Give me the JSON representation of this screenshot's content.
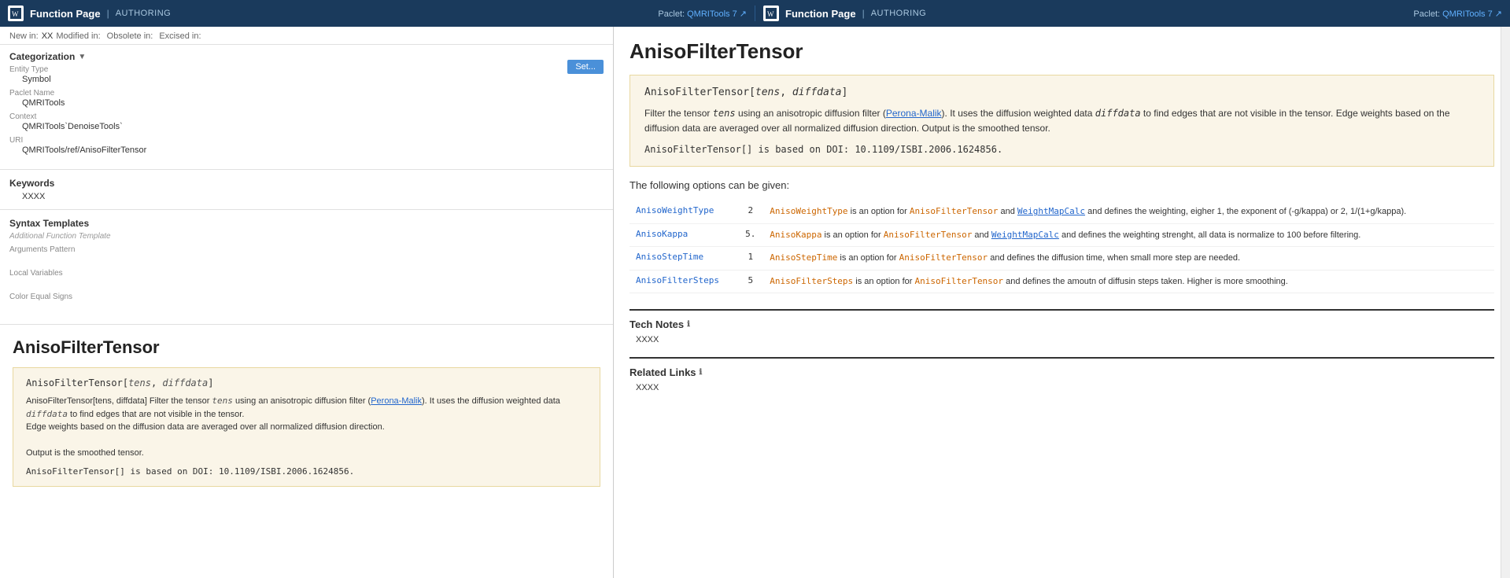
{
  "header": {
    "icon_label": "WL",
    "left_title": "Function Page",
    "separator": "|",
    "left_authoring": "AUTHORING",
    "paclet_label": "Paclet:",
    "paclet_name": "QMRITools",
    "paclet_version": "7",
    "right_title": "Function Page",
    "right_authoring": "AUTHORING"
  },
  "left_panel": {
    "meta": {
      "new_in_label": "New in:",
      "new_in_value": "XX",
      "modified_label": "Modified in:",
      "modified_value": "",
      "obsolete_label": "Obsolete in:",
      "obsolete_value": "",
      "excised_label": "Excised in:",
      "excised_value": ""
    },
    "categorization": {
      "header": "Categorization",
      "entity_type_label": "Entity Type",
      "entity_type_value": "Symbol",
      "paclet_name_label": "Paclet Name",
      "paclet_name_value": "QMRITools",
      "context_label": "Context",
      "context_value": "QMRITools`DenoiseTools`",
      "uri_label": "URI",
      "uri_value": "QMRITools/ref/AnisoFilterTensor"
    },
    "keywords": {
      "header": "Keywords",
      "value": "XXXX"
    },
    "syntax": {
      "header": "Syntax Templates",
      "sub_label": "Additional Function Template",
      "args_pattern_label": "Arguments Pattern",
      "args_pattern_value": "",
      "local_vars_label": "Local Variables",
      "local_vars_value": "",
      "color_equal_label": "Color Equal Signs",
      "color_equal_value": ""
    },
    "set_button": "Set..."
  },
  "function": {
    "title": "AnisoFilterTensor",
    "code_box": {
      "signature": "AnisoFilterTensor[tens, diffdata]",
      "sig_name": "AnisoFilterTensor",
      "sig_arg1": "tens",
      "sig_arg2": "diffdata",
      "description": "Filter the tensor tens using an anisotropic diffusion filter (Perona-Malik). It uses the diffusion weighted data diffdata to find edges that are not visible in the tensor. Edge weights based on the diffusion data are averaged over all normalized diffusion direction. Output is the smoothed tensor.",
      "doi_prefix": "AnisoFilterTensor[] is based on DOI:",
      "doi_value": "10.1109/ISBI.2006.1624856."
    }
  },
  "right_panel": {
    "title": "AnisoFilterTensor",
    "code_box": {
      "signature_name": "AnisoFilterTensor",
      "sig_arg1": "tens",
      "sig_arg2": "diffdata",
      "description_parts": [
        "Filter the tensor ",
        "tens",
        " using an anisotropic diffusion filter (",
        "Perona-Malik",
        "). It uses the diffusion weighted data ",
        "diffdata",
        " to find edges that are not visible in the tensor. Edge weights based on the diffusion data are averaged over all normalized diffusion direction. Output is the smoothed tensor."
      ],
      "doi_code": "AnisoFilterTensor[]",
      "doi_text": "is based on DOI: 10.1109/ISBI.2006.1624856."
    },
    "options_heading": "The following options can be given:",
    "options": [
      {
        "name": "AnisoWeightType",
        "value": "2",
        "description": "AnisoWeightType is an option for AnisoFilterTensor and WeightMapCalc and defines the weighting, eigher 1, the exponent of (-g/kappa) or 2, 1/(1+g/kappa)."
      },
      {
        "name": "AnisoKappa",
        "value": "5.",
        "description": "AnisoKappa is an option for AnisoFilterTensor and WeightMapCalc and defines the weighting strenght, all data is normalize to 100 before filtering."
      },
      {
        "name": "AnisoStepTime",
        "value": "1",
        "description": "AnisoStepTime is an option for AnisoFilterTensor and defines the diffusion time, when small more step are needed."
      },
      {
        "name": "AnisoFilterSteps",
        "value": "5",
        "description": "AnisoFilterSteps is an option for AnisoFilterTensor and defines the amoutn of diffusin steps taken. Higher is more smoothing."
      }
    ],
    "tech_notes": {
      "header": "Tech Notes",
      "value": "XXXX"
    },
    "related_links": {
      "header": "Related Links",
      "value": "XXXX"
    }
  }
}
